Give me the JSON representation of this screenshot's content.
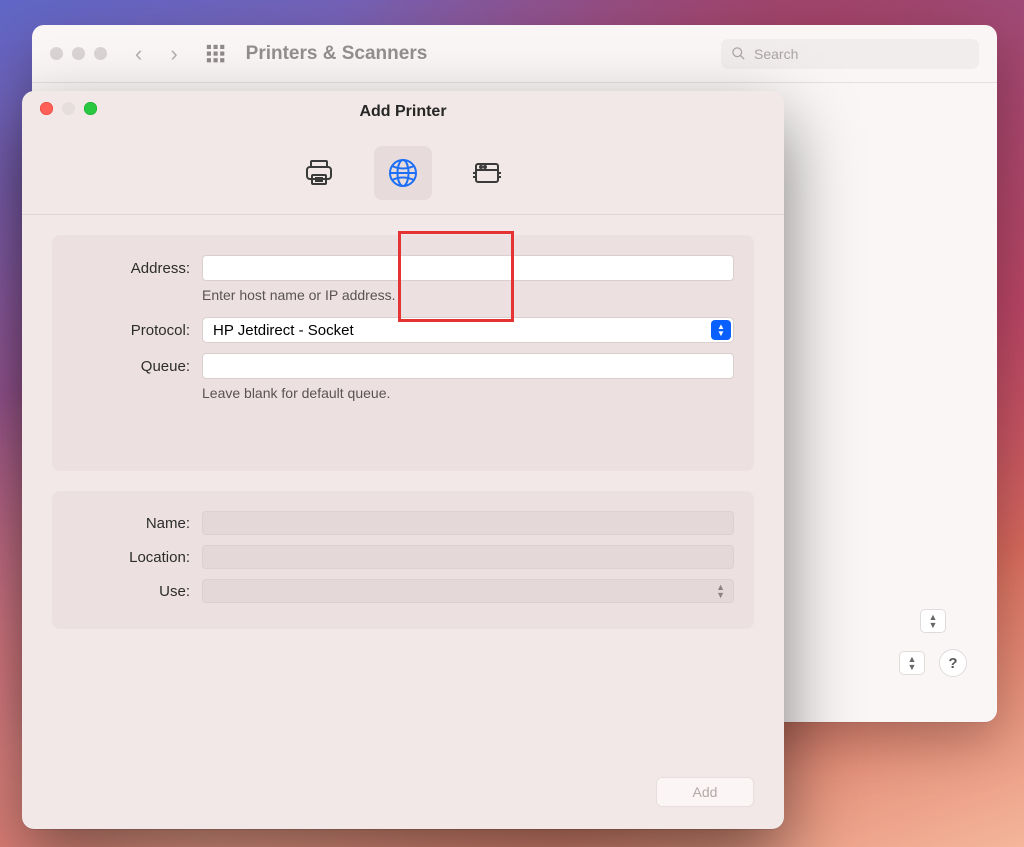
{
  "prefs": {
    "title": "Printers & Scanners",
    "search_placeholder": "Search"
  },
  "addPrinter": {
    "title": "Add Printer",
    "tabs": {
      "default": "default-printer",
      "ip": "ip-printer",
      "windows": "windows-printer"
    },
    "form": {
      "address_label": "Address:",
      "address_value": "",
      "address_hint": "Enter host name or IP address.",
      "protocol_label": "Protocol:",
      "protocol_value": "HP Jetdirect - Socket",
      "queue_label": "Queue:",
      "queue_value": "",
      "queue_hint": "Leave blank for default queue.",
      "name_label": "Name:",
      "name_value": "",
      "location_label": "Location:",
      "location_value": "",
      "use_label": "Use:",
      "use_value": ""
    },
    "add_button": "Add"
  },
  "help_symbol": "?",
  "colors": {
    "highlight": "#e53232",
    "accent_blue": "#0a60ff"
  }
}
